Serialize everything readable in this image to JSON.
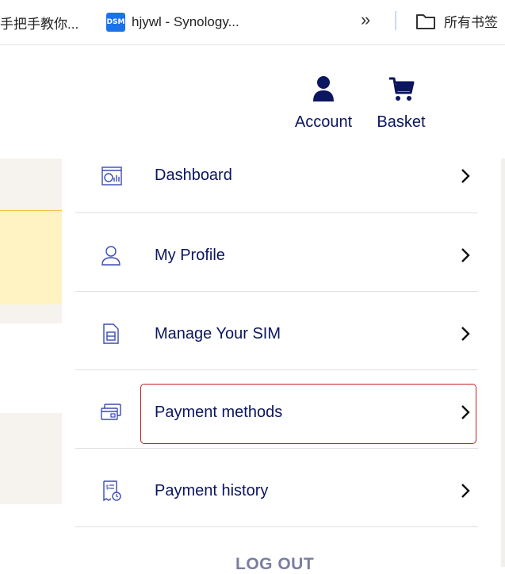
{
  "bookmarks": {
    "item1": "手把手教你...",
    "item2_icon_text": "DSM",
    "item2": "hjywl - Synology...",
    "more": "»",
    "folder": "所有书签"
  },
  "header": {
    "account": "Account",
    "basket": "Basket"
  },
  "menu": {
    "items": [
      {
        "label": "Dashboard",
        "icon": "dashboard-icon"
      },
      {
        "label": "My Profile",
        "icon": "profile-icon"
      },
      {
        "label": "Manage Your SIM",
        "icon": "sim-icon"
      },
      {
        "label": "Payment methods",
        "icon": "card-icon"
      },
      {
        "label": "Payment history",
        "icon": "receipt-icon"
      }
    ],
    "logout": "LOG OUT"
  },
  "colors": {
    "brand": "#0b1560",
    "icon_outline": "#3a4bb5",
    "highlight_border": "#c21f1f",
    "notice_bg": "#fff2c3",
    "beige": "#f6f2ee"
  }
}
